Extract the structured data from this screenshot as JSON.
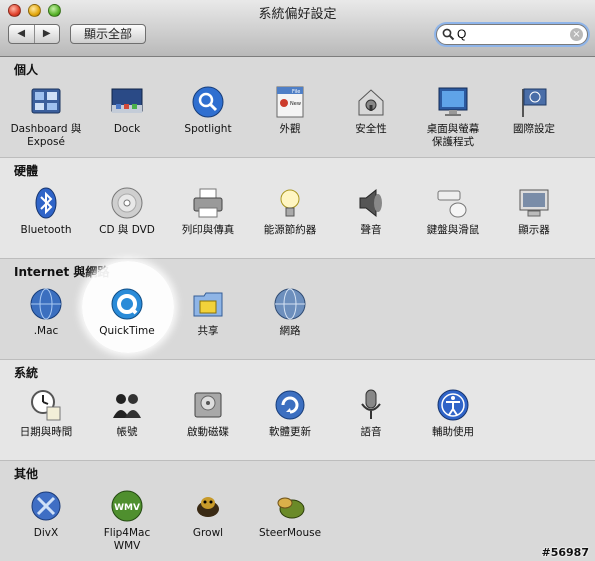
{
  "window": {
    "title": "系統偏好設定"
  },
  "toolbar": {
    "back_label": "◀",
    "forward_label": "▶",
    "show_all_label": "顯示全部"
  },
  "search": {
    "value": "Q",
    "clear_label": "×"
  },
  "sections": [
    {
      "title": "個人",
      "items": [
        {
          "label": "Dashboard 與\nExposé",
          "icon": "dashboard-expose-icon"
        },
        {
          "label": "Dock",
          "icon": "dock-icon"
        },
        {
          "label": "Spotlight",
          "icon": "spotlight-icon"
        },
        {
          "label": "外觀",
          "icon": "appearance-icon"
        },
        {
          "label": "安全性",
          "icon": "security-icon"
        },
        {
          "label": "桌面與螢幕\n保護程式",
          "icon": "desktop-screensaver-icon"
        },
        {
          "label": "國際設定",
          "icon": "international-icon"
        }
      ]
    },
    {
      "title": "硬體",
      "items": [
        {
          "label": "Bluetooth",
          "icon": "bluetooth-icon"
        },
        {
          "label": "CD 與 DVD",
          "icon": "cd-dvd-icon"
        },
        {
          "label": "列印與傳真",
          "icon": "printer-icon"
        },
        {
          "label": "能源節約器",
          "icon": "energy-saver-icon"
        },
        {
          "label": "聲音",
          "icon": "sound-icon"
        },
        {
          "label": "鍵盤與滑鼠",
          "icon": "keyboard-mouse-icon"
        },
        {
          "label": "顯示器",
          "icon": "displays-icon"
        }
      ]
    },
    {
      "title": "Internet 與網路",
      "items": [
        {
          "label": ".Mac",
          "icon": "dotmac-icon"
        },
        {
          "label": "QuickTime",
          "icon": "quicktime-icon"
        },
        {
          "label": "共享",
          "icon": "sharing-icon"
        },
        {
          "label": "網路",
          "icon": "network-icon"
        }
      ]
    },
    {
      "title": "系統",
      "items": [
        {
          "label": "日期與時間",
          "icon": "date-time-icon"
        },
        {
          "label": "帳號",
          "icon": "accounts-icon"
        },
        {
          "label": "啟動磁碟",
          "icon": "startup-disk-icon"
        },
        {
          "label": "軟體更新",
          "icon": "software-update-icon"
        },
        {
          "label": "語音",
          "icon": "speech-icon"
        },
        {
          "label": "輔助使用",
          "icon": "universal-access-icon"
        }
      ]
    },
    {
      "title": "其他",
      "items": [
        {
          "label": "DivX",
          "icon": "divx-icon"
        },
        {
          "label": "Flip4Mac\nWMV",
          "icon": "flip4mac-wmv-icon"
        },
        {
          "label": "Growl",
          "icon": "growl-icon"
        },
        {
          "label": "SteerMouse",
          "icon": "steermouse-icon"
        }
      ]
    }
  ],
  "watermark": "#56987",
  "colors": {
    "spotlight_highlight": "#ffffff",
    "search_focus_ring": "#8fb5ea",
    "window_bg": "#dcdcdc"
  }
}
